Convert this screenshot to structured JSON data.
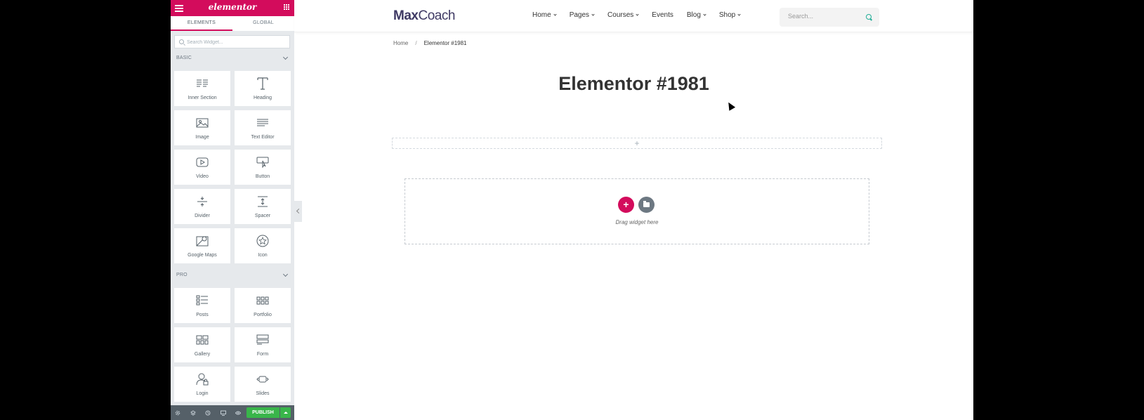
{
  "panel": {
    "logo": "elementor",
    "tabs": [
      "ELEMENTS",
      "GLOBAL"
    ],
    "search_placeholder": "Search Widget...",
    "basic": {
      "title": "BASIC",
      "widgets": [
        {
          "label": "Inner Section",
          "icon": "columns-icon"
        },
        {
          "label": "Heading",
          "icon": "heading-icon"
        },
        {
          "label": "Image",
          "icon": "image-icon"
        },
        {
          "label": "Text Editor",
          "icon": "text-editor-icon"
        },
        {
          "label": "Video",
          "icon": "video-icon"
        },
        {
          "label": "Button",
          "icon": "button-icon"
        },
        {
          "label": "Divider",
          "icon": "divider-icon"
        },
        {
          "label": "Spacer",
          "icon": "spacer-icon"
        },
        {
          "label": "Google Maps",
          "icon": "map-icon"
        },
        {
          "label": "Icon",
          "icon": "star-icon"
        }
      ]
    },
    "pro": {
      "title": "PRO",
      "widgets": [
        {
          "label": "Posts",
          "icon": "posts-icon"
        },
        {
          "label": "Portfolio",
          "icon": "portfolio-icon"
        },
        {
          "label": "Gallery",
          "icon": "gallery-icon"
        },
        {
          "label": "Form",
          "icon": "form-icon"
        },
        {
          "label": "Login",
          "icon": "login-icon"
        },
        {
          "label": "Slides",
          "icon": "slides-icon"
        }
      ]
    },
    "footer": {
      "publish_label": "PUBLISH"
    },
    "colors": {
      "brand": "#d30c5c",
      "publish": "#39b54a"
    }
  },
  "site": {
    "brand_bold": "Max",
    "brand_light": "Coach",
    "nav": [
      {
        "label": "Home",
        "dropdown": true
      },
      {
        "label": "Pages",
        "dropdown": true
      },
      {
        "label": "Courses",
        "dropdown": true
      },
      {
        "label": "Events",
        "dropdown": false
      },
      {
        "label": "Blog",
        "dropdown": true
      },
      {
        "label": "Shop",
        "dropdown": true
      }
    ],
    "search_placeholder": "Search...",
    "accent": "#20ad96"
  },
  "breadcrumb": {
    "home": "Home",
    "sep": "/",
    "current": "Elementor #1981"
  },
  "page": {
    "title": "Elementor #1981",
    "add_section_glyph": "+",
    "add_button_glyph": "+",
    "drop_text": "Drag widget here"
  }
}
